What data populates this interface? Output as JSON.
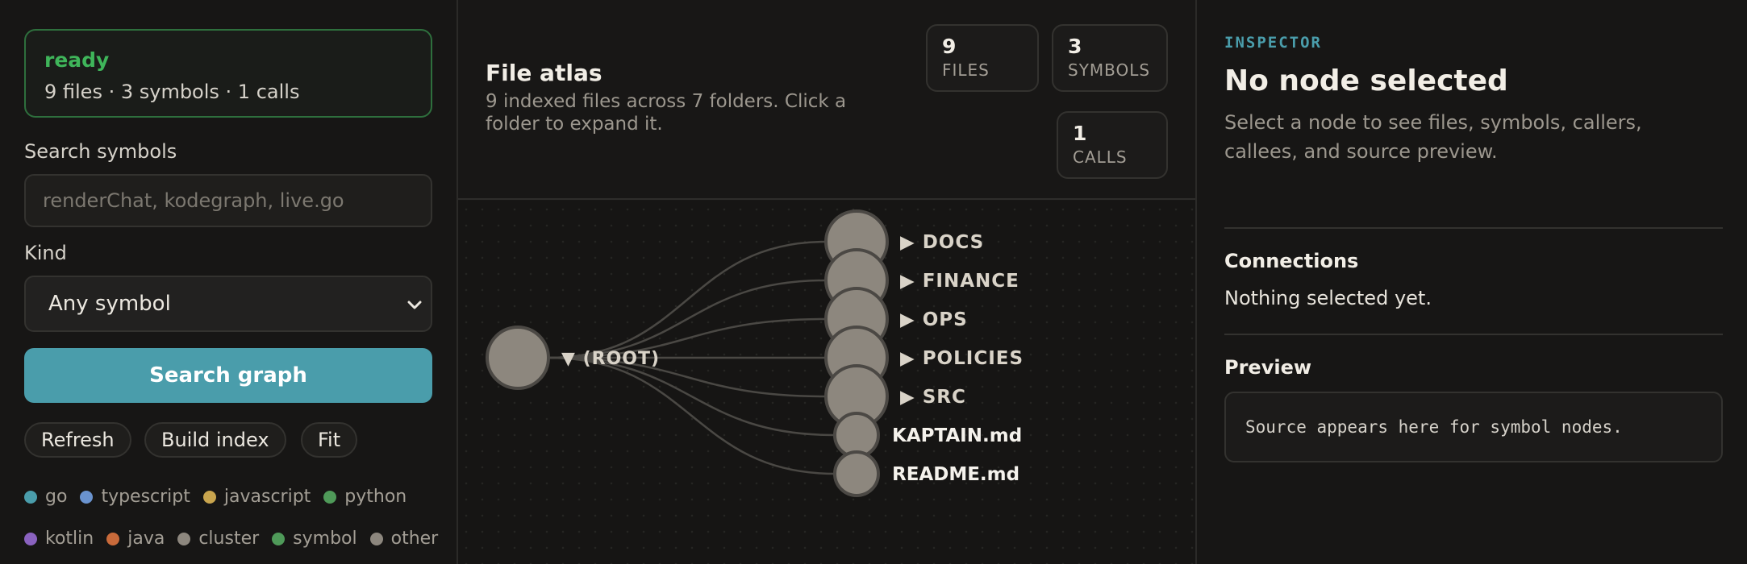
{
  "sidebar": {
    "status": {
      "word": "ready",
      "summary": "9 files · 3 symbols · 1 calls"
    },
    "search": {
      "label": "Search symbols",
      "placeholder": "renderChat, kodegraph, live.go"
    },
    "kind": {
      "label": "Kind",
      "selected": "Any symbol"
    },
    "search_button": "Search graph",
    "actions": {
      "refresh": "Refresh",
      "build_index": "Build index",
      "fit": "Fit"
    },
    "legend": [
      {
        "label": "go",
        "color": "#4a9dab"
      },
      {
        "label": "typescript",
        "color": "#6a93cf"
      },
      {
        "label": "javascript",
        "color": "#c9a54e"
      },
      {
        "label": "python",
        "color": "#4f9a59"
      },
      {
        "label": "kotlin",
        "color": "#8a62bf"
      },
      {
        "label": "java",
        "color": "#c96a3a"
      },
      {
        "label": "cluster",
        "color": "#8d877e"
      },
      {
        "label": "symbol",
        "color": "#4f9a59"
      },
      {
        "label": "other",
        "color": "#8d877e"
      }
    ]
  },
  "atlas": {
    "title": "File atlas",
    "subtitle": "9 indexed files across 7 folders. Click a folder to expand it.",
    "stats": {
      "files": {
        "value": "9",
        "label": "FILES"
      },
      "symbols": {
        "value": "3",
        "label": "SYMBOLS"
      },
      "calls": {
        "value": "1",
        "label": "CALLS"
      }
    },
    "graph": {
      "root": {
        "label": "(ROOT)",
        "marker": "▼"
      },
      "children": [
        {
          "label": "DOCS",
          "kind": "folder",
          "marker": "▶"
        },
        {
          "label": "FINANCE",
          "kind": "folder",
          "marker": "▶"
        },
        {
          "label": "OPS",
          "kind": "folder",
          "marker": "▶"
        },
        {
          "label": "POLICIES",
          "kind": "folder",
          "marker": "▶"
        },
        {
          "label": "SRC",
          "kind": "folder",
          "marker": "▶"
        },
        {
          "label": "KAPTAIN.md",
          "kind": "file",
          "marker": ""
        },
        {
          "label": "README.md",
          "kind": "file",
          "marker": ""
        }
      ],
      "node_color": "#8d877e"
    }
  },
  "inspector": {
    "eyebrow": "INSPECTOR",
    "title": "No node selected",
    "hint": "Select a node to see files, symbols, callers, callees, and source preview.",
    "connections": {
      "title": "Connections",
      "empty": "Nothing selected yet."
    },
    "preview": {
      "title": "Preview",
      "text": "Source appears here for symbol nodes."
    }
  }
}
